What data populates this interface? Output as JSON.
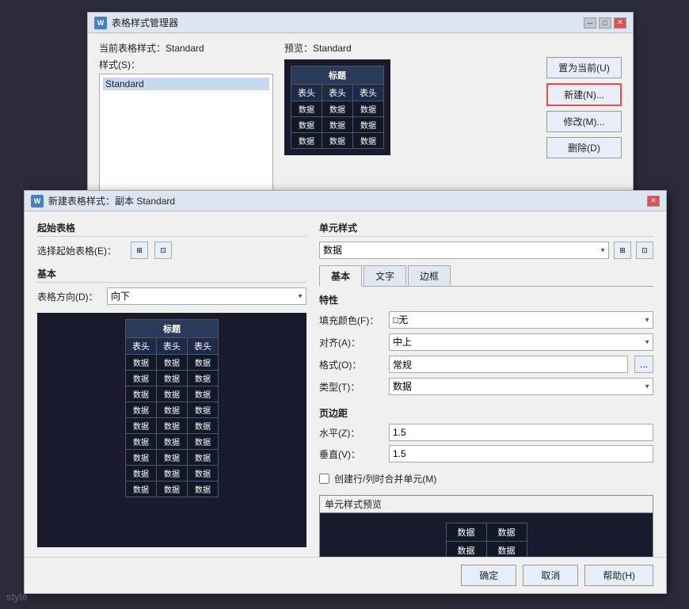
{
  "app": {
    "bg_label": "style"
  },
  "back_dialog": {
    "title": "表格样式管理器",
    "current_style_label": "当前表格样式：Standard",
    "style_label": "样式(S)：",
    "style_items": [
      "Standard"
    ],
    "preview_label": "预览：Standard",
    "preview_table": {
      "title": "标题",
      "headers": [
        "表头",
        "表头",
        "表头"
      ],
      "data_rows": [
        [
          "数据",
          "数据",
          "数据"
        ],
        [
          "数据",
          "数据",
          "数据"
        ],
        [
          "数据",
          "数据",
          "数据"
        ]
      ]
    },
    "buttons": {
      "set_current": "置为当前(U)",
      "new": "新建(N)...",
      "modify": "修改(M)...",
      "delete": "删除(D)"
    }
  },
  "main_dialog": {
    "title": "新建表格样式：副本 Standard",
    "start_table_section": "起始表格",
    "select_start_label": "选择起始表格(E)：",
    "basic_section": "基本",
    "table_direction_label": "表格方向(D)：",
    "table_direction_value": "向下",
    "preview_table": {
      "title": "标题",
      "headers": [
        "表头",
        "表头",
        "表头"
      ],
      "data_rows": [
        [
          "数据",
          "数据",
          "数据"
        ],
        [
          "数据",
          "数据",
          "数据"
        ],
        [
          "数据",
          "数据",
          "数据"
        ],
        [
          "数据",
          "数据",
          "数据"
        ],
        [
          "数据",
          "数据",
          "数据"
        ],
        [
          "数据",
          "数据",
          "数据"
        ],
        [
          "数据",
          "数据",
          "数据"
        ],
        [
          "数据",
          "数据",
          "数据"
        ],
        [
          "数据",
          "数据",
          "数据"
        ]
      ]
    },
    "cell_style_section": "单元样式",
    "cell_style_value": "数据",
    "tabs": [
      "基本",
      "文字",
      "边框"
    ],
    "active_tab": "基本",
    "properties": {
      "title": "特性",
      "fill_color_label": "填充颜色(F)：",
      "fill_color_value": "□无",
      "align_label": "对齐(A)：",
      "align_value": "中上",
      "format_label": "格式(O)：",
      "format_value": "常规",
      "type_label": "类型(T)：",
      "type_value": "数据"
    },
    "margins": {
      "title": "页边距",
      "horizontal_label": "水平(Z)：",
      "horizontal_value": "1.5",
      "vertical_label": "垂直(V)：",
      "vertical_value": "1.5"
    },
    "merge_checkbox_label": "创建行/列时合并单元(M)",
    "cell_preview_label": "单元样式预览",
    "cell_preview_data": [
      [
        "数据",
        "数据"
      ],
      [
        "数据",
        "数据"
      ]
    ],
    "footer": {
      "ok": "确定",
      "cancel": "取消",
      "help": "帮助(H)"
    }
  }
}
